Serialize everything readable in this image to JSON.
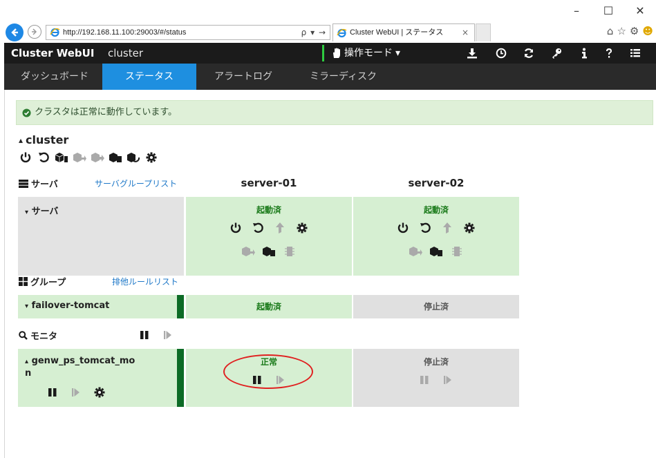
{
  "browser": {
    "address_url": "http://192.168.11.100:29003/#/status",
    "address_tools": "ρ ▾ →",
    "tab_title": "Cluster WebUI | ステータス",
    "tab_close": "×",
    "window_controls": [
      "–",
      "☐",
      "✕"
    ]
  },
  "topbar": {
    "brand": "Cluster WebUI",
    "cluster_name": "cluster",
    "mode_label": "操作モード",
    "mode_caret": "▾"
  },
  "nav": {
    "tabs": [
      {
        "label": "ダッシュボード",
        "active": false
      },
      {
        "label": "ステータス",
        "active": true
      },
      {
        "label": "アラートログ",
        "active": false
      },
      {
        "label": "ミラーディスク",
        "active": false
      }
    ]
  },
  "alert": {
    "message": "クラスタは正常に動作しています。"
  },
  "cluster": {
    "title": "cluster",
    "caret": "▴"
  },
  "servers_section": {
    "label": "サーバ",
    "link": "サーバグループリスト",
    "columns": [
      "server-01",
      "server-02"
    ],
    "row_label": "サーバ",
    "row_caret": "▾",
    "status": [
      "起動済",
      "起動済"
    ]
  },
  "groups_section": {
    "label": "グループ",
    "link": "排他ルールリスト",
    "row_label": "failover-tomcat",
    "row_caret": "▾",
    "status": [
      "起動済",
      "停止済"
    ]
  },
  "monitors_section": {
    "label": "モニタ",
    "row_label_line1": "genw_ps_tomcat_mo",
    "row_label_line2": "n",
    "row_caret": "▴",
    "status": [
      "正常",
      "停止済"
    ]
  },
  "colors": {
    "accent_blue": "#1e8fe0",
    "topbar_bg": "#1b1b1b",
    "online_green_bg": "#d6efd2",
    "offline_gray_bg": "#e0e0e0",
    "status_green_text": "#1a7a1a",
    "annotation_red": "#e02020"
  }
}
